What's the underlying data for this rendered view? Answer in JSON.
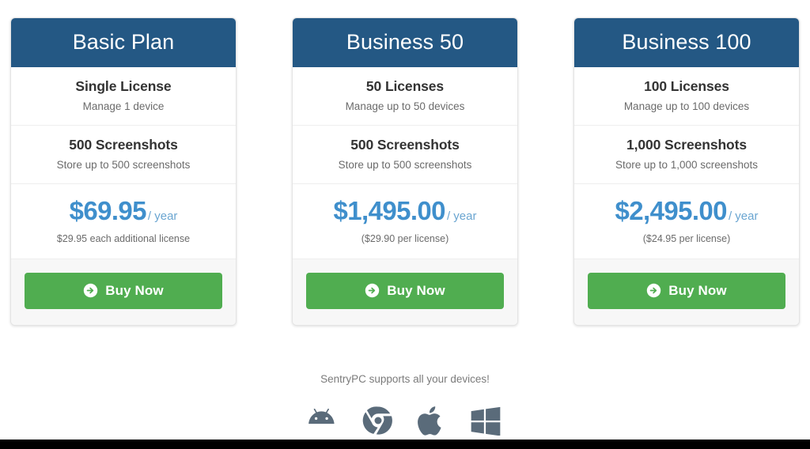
{
  "plans": [
    {
      "name": "Basic Plan",
      "licenses_title": "Single License",
      "licenses_sub": "Manage 1 device",
      "screenshots_title": "500 Screenshots",
      "screenshots_sub": "Store up to 500 screenshots",
      "price_amount": "$69.95",
      "price_period": "/ year",
      "price_note": "$29.95 each additional license",
      "buy_label": "Buy Now"
    },
    {
      "name": "Business 50",
      "licenses_title": "50 Licenses",
      "licenses_sub": "Manage up to 50 devices",
      "screenshots_title": "500 Screenshots",
      "screenshots_sub": "Store up to 500 screenshots",
      "price_amount": "$1,495.00",
      "price_period": "/ year",
      "price_note": "($29.90 per license)",
      "buy_label": "Buy Now"
    },
    {
      "name": "Business 100",
      "licenses_title": "100 Licenses",
      "licenses_sub": "Manage up to 100 devices",
      "screenshots_title": "1,000 Screenshots",
      "screenshots_sub": "Store up to 1,000 screenshots",
      "price_amount": "$2,495.00",
      "price_period": "/ year",
      "price_note": "($24.95 per license)",
      "buy_label": "Buy Now"
    }
  ],
  "footer": {
    "devices_note": "SentryPC supports all your devices!",
    "os_icons": [
      "android-icon",
      "chrome-icon",
      "apple-icon",
      "windows-icon"
    ]
  },
  "colors": {
    "header_blue": "#245884",
    "price_blue": "#3f8fcc",
    "buy_green": "#50ad50",
    "footer_gray": "#f7f7f7",
    "icon_gray": "#5a6b7a",
    "bottom_bar": "#000000"
  }
}
